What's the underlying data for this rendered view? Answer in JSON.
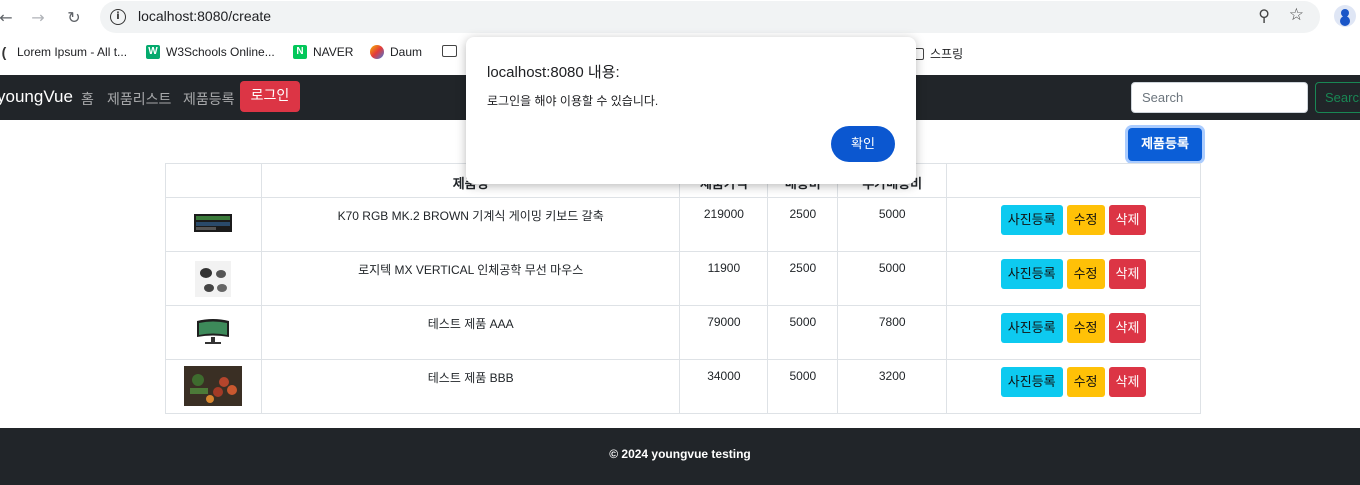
{
  "browser": {
    "url": "localhost:8080/create",
    "bookmarks": [
      {
        "label": "Lorem Ipsum - All t..."
      },
      {
        "label": "W3Schools Online..."
      },
      {
        "label": "NAVER"
      },
      {
        "label": "Daum"
      },
      {
        "label": ""
      },
      {
        "label": "스프링"
      }
    ]
  },
  "navbar": {
    "brand": "youngVue",
    "links": [
      "홈",
      "제품리스트",
      "제품등록"
    ],
    "login_label": "로그인",
    "search_placeholder": "Search",
    "search_button": "Search"
  },
  "main": {
    "register_button": "제품등록",
    "table": {
      "headers": [
        "",
        "제품명",
        "제품가격",
        "배송비",
        "추가배송비",
        ""
      ],
      "rows": [
        {
          "thumb": "keyboard-image",
          "name": "K70 RGB MK.2 BROWN 기계식 게이밍 키보드 갈축",
          "price": "219000",
          "shipping": "2500",
          "extra": "5000"
        },
        {
          "thumb": "mouse-image",
          "name": "로지텍 MX VERTICAL 인체공학 무선 마우스",
          "price": "11900",
          "shipping": "2500",
          "extra": "5000"
        },
        {
          "thumb": "monitor-image",
          "name": "테스트 제품 AAA",
          "price": "79000",
          "shipping": "5000",
          "extra": "7800"
        },
        {
          "thumb": "fruit-image",
          "name": "테스트 제품 BBB",
          "price": "34000",
          "shipping": "5000",
          "extra": "3200"
        }
      ],
      "actions": {
        "photo": "사진등록",
        "edit": "수정",
        "delete": "삭제"
      }
    }
  },
  "footer": {
    "text": "© 2024 youngvue testing"
  },
  "dialog": {
    "title": "localhost:8080 내용:",
    "message": "로그인을 해야 이용할 수 있습니다.",
    "ok": "확인"
  },
  "colors": {
    "navbar": "#212529",
    "danger": "#dc3545",
    "info": "#0dcaf0",
    "warning": "#ffc107",
    "primary": "#0b5ed7"
  }
}
